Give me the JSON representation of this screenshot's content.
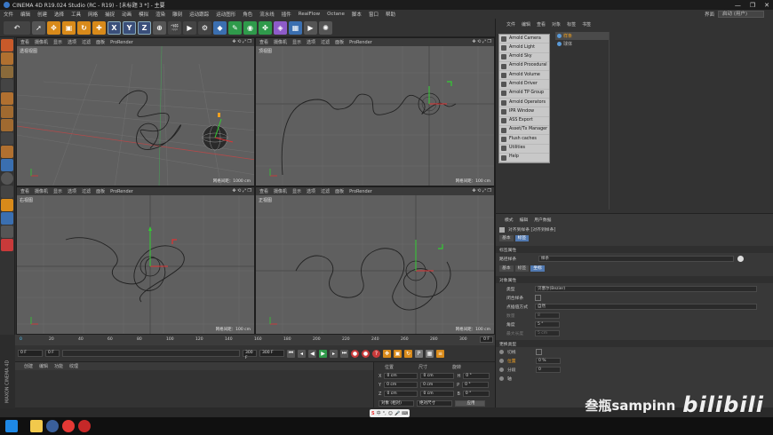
{
  "window": {
    "title": "CINEMA 4D R19.024 Studio (RC - R19) - [未标题 3 *] - 主要",
    "controls": [
      "—",
      "❐",
      "✕"
    ]
  },
  "menubar": {
    "items": [
      "文件",
      "编辑",
      "创建",
      "选择",
      "工具",
      "网格",
      "捕捉",
      "动画",
      "模拟",
      "渲染",
      "雕刻",
      "运动跟踪",
      "运动图形",
      "角色",
      "流水线",
      "插件",
      "RealFlow",
      "Octane",
      "脚本",
      "窗口",
      "帮助"
    ],
    "layout_label": "界面",
    "layout_value": "启动 (用户)"
  },
  "toolbar": {
    "axis_x": "X",
    "axis_y": "Y",
    "axis_z": "Z"
  },
  "viewports": [
    {
      "name": "透视视图",
      "menu": [
        "查看",
        "摄像机",
        "显示",
        "选项",
        "过滤",
        "面板",
        "ProRender"
      ],
      "footer": "网格间距：1000 cm"
    },
    {
      "name": "顶视图",
      "menu": [
        "查看",
        "摄像机",
        "显示",
        "选项",
        "过滤",
        "面板",
        "ProRender"
      ],
      "footer": "网格间距：100 cm"
    },
    {
      "name": "右视图",
      "menu": [
        "查看",
        "摄像机",
        "显示",
        "选项",
        "过滤",
        "面板",
        "ProRender"
      ],
      "footer": "网格间距：100 cm"
    },
    {
      "name": "正视图",
      "menu": [
        "查看",
        "摄像机",
        "显示",
        "选项",
        "过滤",
        "面板",
        "ProRender"
      ],
      "footer": "网格间距：100 cm"
    }
  ],
  "timeline": {
    "ticks": [
      "0",
      "20",
      "40",
      "60",
      "80",
      "100",
      "120",
      "140",
      "160",
      "180",
      "200",
      "220",
      "240",
      "260",
      "280",
      "300"
    ],
    "end_frame": "0 F",
    "start_field": "0 F",
    "current_field": "0 F",
    "max_field": "300 F",
    "max_field2": "300 F"
  },
  "material_panel": {
    "menu": [
      "创建",
      "编辑",
      "功能",
      "纹理"
    ]
  },
  "coord_panel": {
    "headers": [
      "位置",
      "尺寸",
      "旋转"
    ],
    "rows": [
      {
        "axis": "X",
        "pos": "0 cm",
        "size": "0 cm",
        "rot_label": "H",
        "rot": "0 °"
      },
      {
        "axis": "Y",
        "pos": "0 cm",
        "size": "0 cm",
        "rot_label": "P",
        "rot": "0 °"
      },
      {
        "axis": "Z",
        "pos": "0 cm",
        "size": "0 cm",
        "rot_label": "B",
        "rot": "0 °"
      }
    ],
    "mode_select": "对象 (相对)",
    "size_select": "绝对尺寸",
    "apply_button": "应用"
  },
  "object_manager": {
    "tabs": [
      "文件",
      "编辑",
      "查看",
      "对象",
      "标签",
      "书签"
    ],
    "objects": [
      "样条",
      "球体"
    ]
  },
  "arnold_menu": {
    "items": [
      "Arnold Camera",
      "Arnold Light",
      "Arnold Sky",
      "Arnold Procedural",
      "Arnold Volume",
      "Arnold Driver",
      "Arnold TP Group",
      "Arnold Operators",
      "IPR Window",
      "ASS Export",
      "Asset/Tx Manager",
      "Flush caches",
      "Utilities",
      "Help"
    ]
  },
  "attributes": {
    "tabs": [
      "模式",
      "编辑",
      "用户数据"
    ],
    "title": "对齐到样条 [对齐到样条]",
    "basic_tabs": [
      "基本",
      "标签"
    ],
    "section_tag": "标签属性",
    "path_label": "路径样条",
    "path_value": "样条",
    "sub_tabs": [
      "基本",
      "标签",
      "坐标"
    ],
    "section_obj": "对象属性",
    "props": [
      {
        "label": "类型",
        "value": "贝塞尔(Bezier)"
      },
      {
        "label": "闭合样条",
        "value": ""
      },
      {
        "label": "点插值方式",
        "value": "自然"
      },
      {
        "label": "数量",
        "value": "8"
      },
      {
        "label": "角度",
        "value": "5 °"
      },
      {
        "label": "最大长度",
        "value": "5 cm"
      }
    ],
    "section_more": "更换类型",
    "pos_label": "切线",
    "pos_value": "0",
    "pct_label": "位置",
    "pct_value": "0 %",
    "seg_label": "分段",
    "seg_value": "0",
    "axis_label": "轴"
  },
  "watermark": {
    "author": "叁瓶sampinn",
    "site": "bilibili"
  },
  "side_brand": "MAXON CINEMA 4D"
}
